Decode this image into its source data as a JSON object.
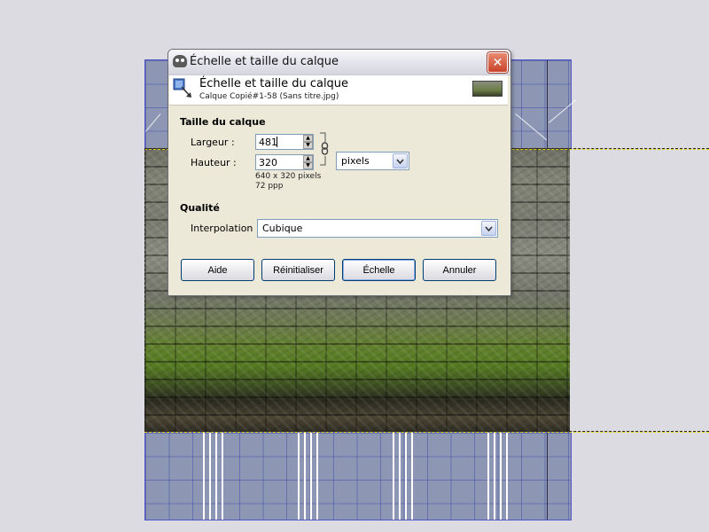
{
  "dialog": {
    "window_title": "Échelle et taille du calque",
    "header_title": "Échelle et taille du calque",
    "header_subtitle": "Calque Copié#1-58 (Sans titre.jpg)",
    "close_icon": "close-icon",
    "app_icon": "gimp-icon",
    "header_icon": "scale-layer-icon"
  },
  "layer_size": {
    "title": "Taille du calque",
    "width_label": "Largeur :",
    "width_value": "481",
    "height_label": "Hauteur :",
    "height_value": "320",
    "units": "pixels",
    "size_info": "640 x 320 pixels",
    "resolution_info": "72 ppp",
    "chain_icon": "chain-link-icon"
  },
  "quality": {
    "title": "Qualité",
    "interpolation_label": "Interpolation :",
    "interpolation_value": "Cubique"
  },
  "buttons": {
    "help": "Aide",
    "reset": "Réinitialiser",
    "scale": "Échelle",
    "cancel": "Annuler"
  },
  "colors": {
    "grid": "#8d97b4",
    "grid_border": "#4f55c4",
    "dialog_bg": "#ece9d8",
    "selection_dash": "#e2d800"
  }
}
